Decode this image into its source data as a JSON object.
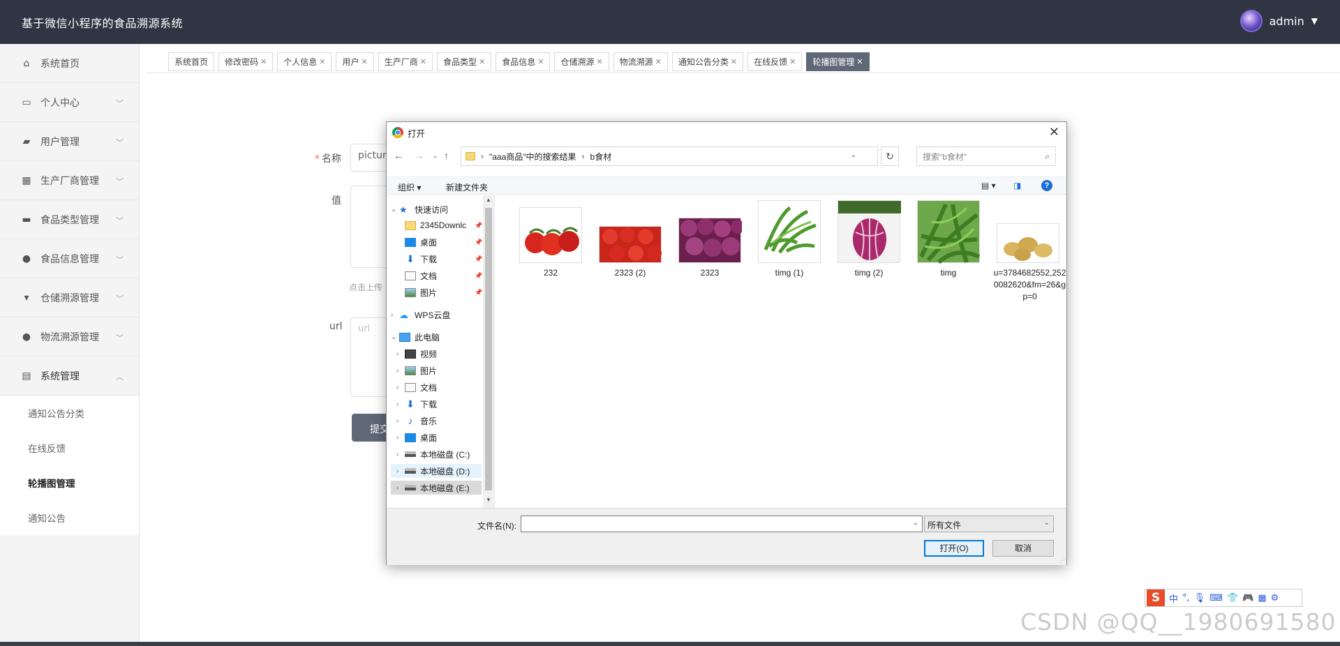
{
  "app": {
    "title": "基于微信小程序的食品溯源系统",
    "user": "admin"
  },
  "sidebar": {
    "items": [
      {
        "label": "系统首页",
        "icon": "home-icon"
      },
      {
        "label": "个人中心",
        "icon": "card-icon"
      },
      {
        "label": "用户管理",
        "icon": "users-icon"
      },
      {
        "label": "生产厂商管理",
        "icon": "grid-icon"
      },
      {
        "label": "食品类型管理",
        "icon": "chat-icon"
      },
      {
        "label": "食品信息管理",
        "icon": "bulb-icon"
      },
      {
        "label": "仓储溯源管理",
        "icon": "cup-icon"
      },
      {
        "label": "物流溯源管理",
        "icon": "person-icon"
      },
      {
        "label": "系统管理",
        "icon": "clipboard-icon"
      }
    ],
    "sub_items": [
      "通知公告分类",
      "在线反馈",
      "轮播图管理",
      "通知公告"
    ]
  },
  "tabs": [
    "系统首页",
    "修改密码",
    "个人信息",
    "用户",
    "生产厂商",
    "食品类型",
    "食品信息",
    "仓储溯源",
    "物流溯源",
    "通知公告分类",
    "在线反馈",
    "轮播图管理"
  ],
  "form": {
    "name_label": "名称",
    "name_value": "picture",
    "value_label": "值",
    "upload_hint": "点击上传",
    "url_label": "url",
    "url_placeholder": "url",
    "submit": "提交"
  },
  "dialog": {
    "title": "打开",
    "path": [
      "\"aaa商品\"中的搜索结果",
      "b食材"
    ],
    "search_placeholder": "搜索\"b食材\"",
    "organize": "组织 ▾",
    "new_folder": "新建文件夹",
    "help": "?",
    "tree": {
      "quick_access": "快速访问",
      "quick_items": [
        "2345Downlc",
        "桌面",
        "下载",
        "文档",
        "图片"
      ],
      "wps": "WPS云盘",
      "this_pc": "此电脑",
      "pc_items": [
        "视频",
        "图片",
        "文档",
        "下载",
        "音乐",
        "桌面",
        "本地磁盘 (C:)",
        "本地磁盘 (D:)",
        "本地磁盘 (E:)"
      ]
    },
    "files": [
      "232",
      "2323 (2)",
      "2323",
      "timg (1)",
      "timg (2)",
      "timg",
      "u=3784682552,2520082620&fm=26&gp=0"
    ],
    "filename_label": "文件名(N):",
    "filename_value": "",
    "filetype": "所有文件",
    "open_button": "打开(O)",
    "cancel_button": "取消"
  },
  "ime": {
    "logo": "S",
    "mode": "中"
  },
  "watermark": "CSDN @QQ__1980691580"
}
